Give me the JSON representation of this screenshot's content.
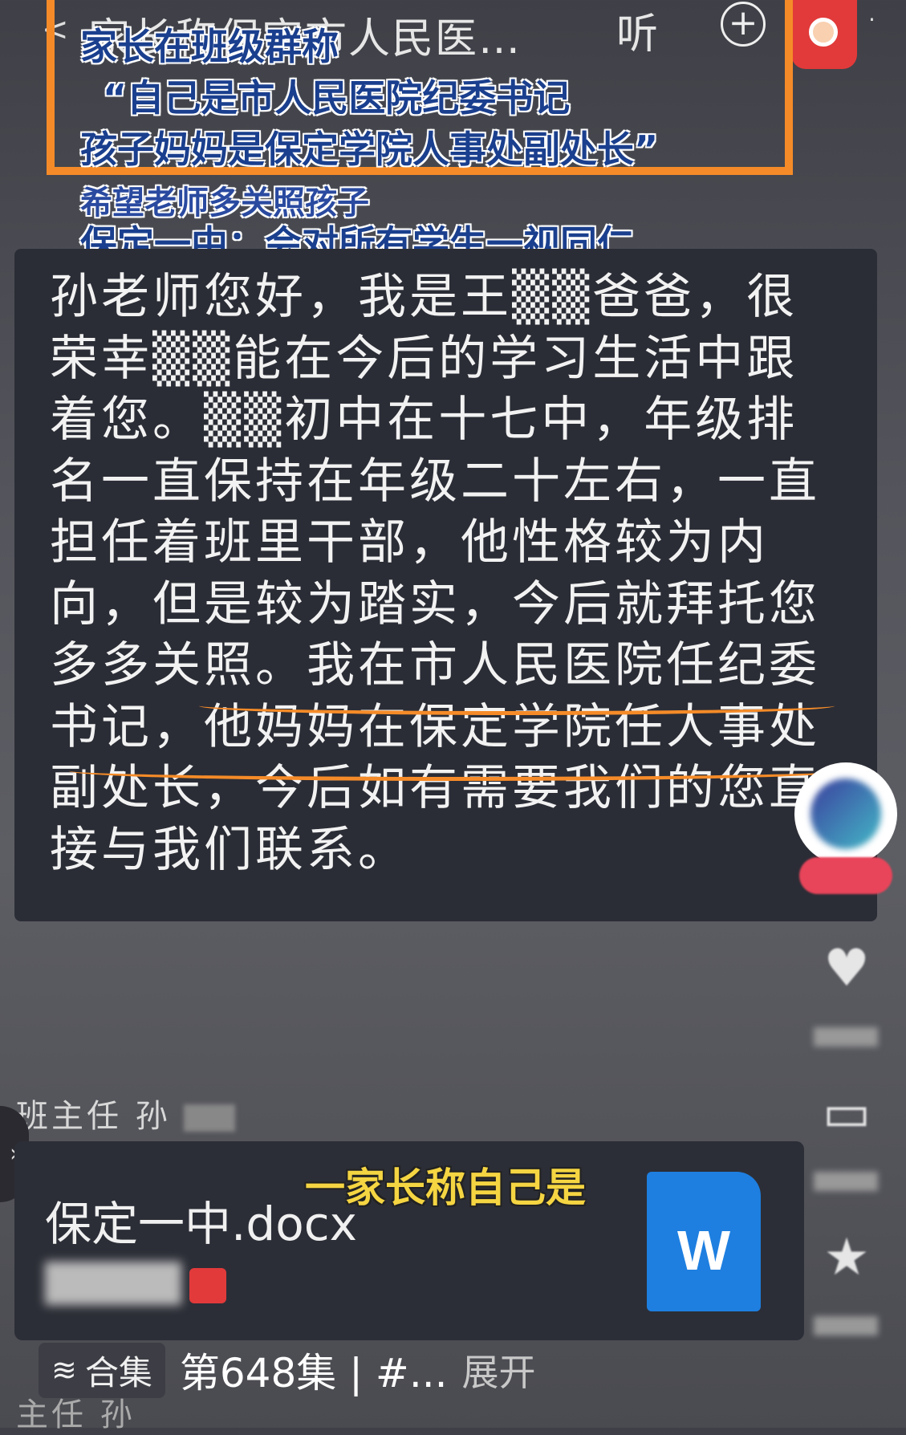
{
  "top_bar": {
    "back": "<",
    "title": "家长称保定市人民医…",
    "listen": "听",
    "plus": "+",
    "more": "·"
  },
  "headline": {
    "line1": "家长在班级群称",
    "line2": "“自己是市人民医院纪委书记",
    "line3": "孩子妈妈是保定学院人事处副处长”",
    "line4": "希望老师多关照孩子",
    "line5": "保定一中：会对所有学生一视同仁"
  },
  "message": {
    "text": "孙老师您好，我是王▒▒爸爸，很荣幸▒▒能在今后的学习生活中跟着您。▒▒初中在十七中，年级排名一直保持在年级二十左右，一直担任着班里干部，他性格较为内向，但是较为踏实，今后就拜托您多多关照。我在市人民医院任纪委书记，他妈妈在保定学院任人事处副处长，今后如有需要我们的您直接与我们联系。"
  },
  "sender": {
    "name": "班主任 孙"
  },
  "file": {
    "name": "保定一中.docx",
    "icon_letter": "W",
    "icon_color": "#1e7fe0"
  },
  "caption": "一家长称自己是",
  "bottom": {
    "collection_label": "合集",
    "episode": "第648集 | #...",
    "expand": "展开",
    "sender2": "主任 孙"
  },
  "colors": {
    "highlight": "#f58b28",
    "headline_text": "#1a3f8e",
    "caption_text": "#f5d542"
  }
}
